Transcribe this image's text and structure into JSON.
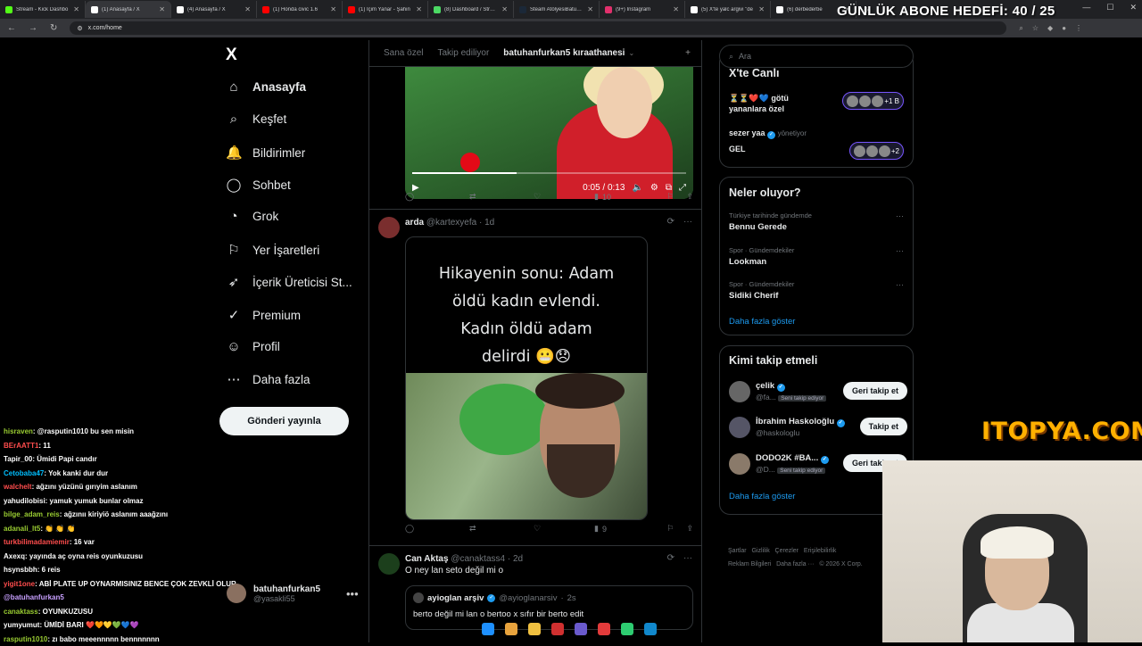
{
  "browser": {
    "tabs": [
      {
        "label": "Stream - Kick Dashbo",
        "color": "#53fc18"
      },
      {
        "label": "(1) Anasayfa / X",
        "color": "#ffffff"
      },
      {
        "label": "(4) Anasayfa / X",
        "color": "#ffffff"
      },
      {
        "label": "(1) Honda civic 1.6",
        "color": "#ff0000"
      },
      {
        "label": "(1) İçim Yanar - Şahin",
        "color": "#ff0000"
      },
      {
        "label": "(8) Dashboard / Stream",
        "color": "#4cd964"
      },
      {
        "label": "Steam AtölyesiBatuhan",
        "color": "#1b2838"
      },
      {
        "label": "(9+) Instagram",
        "color": "#e1306c"
      },
      {
        "label": "(5) X'te yalc argivi \"de",
        "color": "#ffffff"
      },
      {
        "label": "(6) derbederbe",
        "color": "#ffffff"
      }
    ],
    "url": "x.com/home"
  },
  "overlay": {
    "goal": "GÜNLÜK ABONE HEDEFİ: 40 / 25",
    "sponsor": "ITOPYA.COM"
  },
  "nav": {
    "logo": "X",
    "items": [
      {
        "label": "Anasayfa",
        "icon": "⌂"
      },
      {
        "label": "Keşfet",
        "icon": "⌕"
      },
      {
        "label": "Bildirimler",
        "icon": "🔔"
      },
      {
        "label": "Sohbet",
        "icon": "◯"
      },
      {
        "label": "Grok",
        "icon": "◔"
      },
      {
        "label": "Yer İşaretleri",
        "icon": "⚐"
      },
      {
        "label": "İçerik Üreticisi St...",
        "icon": "➶"
      },
      {
        "label": "Premium",
        "icon": "✓"
      },
      {
        "label": "Profil",
        "icon": "☺"
      },
      {
        "label": "Daha fazla",
        "icon": "⋯"
      }
    ],
    "post_button": "Gönderi yayınla",
    "account": {
      "name": "batuhanfurkan5",
      "handle": "@yasakli55"
    }
  },
  "chat": [
    {
      "user": "hisraven",
      "text": ": @rasputin1010 bu sen misin",
      "color": "#9acd32"
    },
    {
      "user": "BErAATT1",
      "text": ": 11",
      "color": "#ff4d4d"
    },
    {
      "user": "Tapir_00",
      "text": ": Ümidi Papi candır",
      "color": "#ffffff"
    },
    {
      "user": "Cetobaba47",
      "text": ": Yok kanki dur dur",
      "color": "#00bfff"
    },
    {
      "user": "walchelt",
      "text": ": ağzını yüzünü gırıyim aslanım",
      "color": "#ff4d4d"
    },
    {
      "user": "yahudilobisi",
      "text": ": yamuk yumuk bunlar olmaz",
      "color": "#ffffff"
    },
    {
      "user": "bilge_adam_reis",
      "text": ": ağzınıı kiriyiö aslanım aaağzını",
      "color": "#9acd32"
    },
    {
      "user": "adanali_lt5",
      "text": ": 👏 👏 👏",
      "color": "#9acd32"
    },
    {
      "user": "turkbilimadamiemir",
      "text": ": 16 var",
      "color": "#ff4d4d"
    },
    {
      "user": "Axexq",
      "text": ": yayında aç oyna reis oyunkuzusu",
      "color": "#ffffff"
    },
    {
      "user": "hsynsbbh",
      "text": ": 6 reis",
      "color": "#ffffff"
    },
    {
      "user": "yigit1one",
      "text": ": ABİ PLATE UP OYNARMISINIZ BENCE ÇOK ZEVKLİ OLUR",
      "color": "#ff4d4d"
    },
    {
      "user": "",
      "text": "@batuhanfurkan5",
      "color": "#c8a0ff"
    },
    {
      "user": "canaktass",
      "text": ": OYUNKUZUSU",
      "color": "#9acd32"
    },
    {
      "user": "yumyumut",
      "text": ": ÜMİDİ BARI ❤️🧡💛💚💙💜",
      "color": "#ffffff"
    },
    {
      "user": "rasputin1010",
      "text": ": zı babo meeennnnn bennnnnnn",
      "color": "#9acd32"
    }
  ],
  "timeline": {
    "tabs": [
      "Sana özel",
      "Takip ediliyor",
      "batuhanfurkan5 kıraathanesi"
    ],
    "video_post": {
      "time": "0:05 / 0:13",
      "progress": 0.38,
      "actions": {
        "reply": "",
        "repost": "",
        "like": "",
        "views": "10"
      }
    },
    "post2": {
      "name": "arda",
      "handle": "@kartexyefa",
      "time": "1d",
      "image_lines": [
        "Hikayenin sonu: Adam",
        "öldü kadın evlendi.",
        "Kadın öldü adam",
        "delirdi 😬😞"
      ],
      "actions": {
        "views": "9"
      }
    },
    "post3": {
      "name": "Can Aktaş",
      "handle": "@canaktass4",
      "time": "2d",
      "text": "O ney lan seto değil mi o",
      "quote": {
        "name": "ayioglan arşiv",
        "handle": "@ayioglanarsiv",
        "time": "2s",
        "text": "berto değil mi lan o bertoo x sıfır bir berto edit"
      }
    }
  },
  "right": {
    "search_placeholder": "Ara",
    "live": {
      "title": "X'te Canlı",
      "items": [
        {
          "line1": "⏳⏳❤️💙 götü",
          "line2": "yananlara özel",
          "count": "+1 B"
        },
        {
          "host": "sezer yaa",
          "role": "yönetiyor",
          "title": "GEL",
          "count": "+2"
        }
      ]
    },
    "trends": {
      "title": "Neler oluyor?",
      "items": [
        {
          "cat": "Türkiye tarihinde gündemde",
          "name": "Bennu Gerede"
        },
        {
          "cat": "Spor · Gündemdekiler",
          "name": "Lookman"
        },
        {
          "cat": "Spor · Gündemdekiler",
          "name": "Sidiki Cherif"
        }
      ],
      "more": "Daha fazla göster"
    },
    "who": {
      "title": "Kimi takip etmeli",
      "items": [
        {
          "name": "çelik",
          "handle": "@fa...",
          "badge": "Seni takip ediyor",
          "button": "Geri takip et"
        },
        {
          "name": "İbrahim Haskoloğlu",
          "handle": "@haskologlu",
          "badge": "",
          "button": "Takip et"
        },
        {
          "name": "DODO2K #BA...",
          "handle": "@D...",
          "badge": "Seni takip ediyor",
          "button": "Geri takip et"
        }
      ],
      "more": "Daha fazla göster"
    },
    "footer": [
      "Şartlar",
      "Gizlilik",
      "Çerezler",
      "Erişilebilirlik",
      "Reklam Bilgileri",
      "Daha fazla ···",
      "© 2026 X Corp."
    ]
  }
}
